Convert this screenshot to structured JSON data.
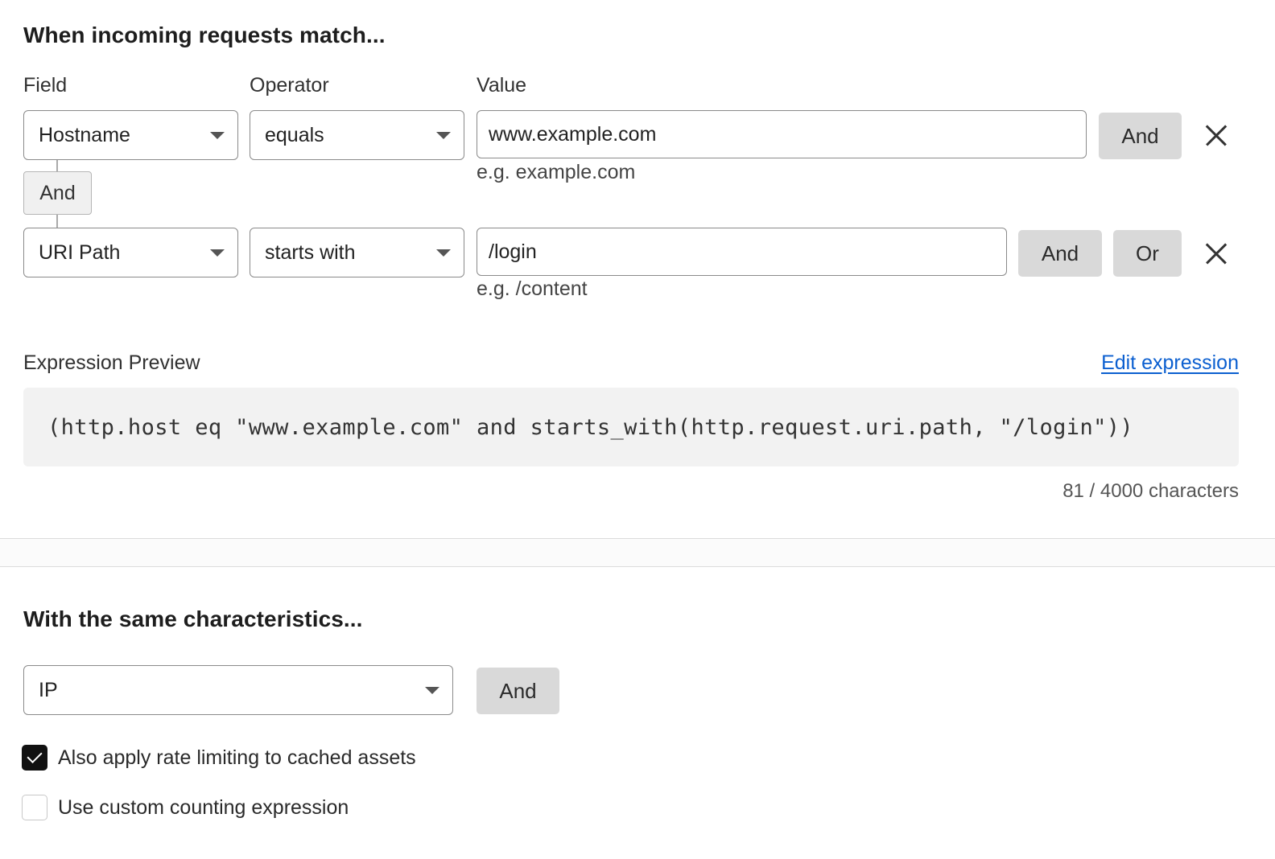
{
  "match_section": {
    "title": "When incoming requests match...",
    "columns": {
      "field": "Field",
      "operator": "Operator",
      "value": "Value"
    },
    "rows": [
      {
        "field": "Hostname",
        "operator": "equals",
        "value": "www.example.com",
        "hint": "e.g. example.com",
        "and_label": "And"
      },
      {
        "field": "URI Path",
        "operator": "starts with",
        "value": "/login",
        "hint": "e.g. /content",
        "and_label": "And",
        "or_label": "Or"
      }
    ],
    "connector_label": "And"
  },
  "expression": {
    "label": "Expression Preview",
    "edit_link": "Edit expression",
    "code": "(http.host eq \"www.example.com\" and starts_with(http.request.uri.path, \"/login\"))",
    "counter": "81 / 4000 characters"
  },
  "characteristics": {
    "title": "With the same characteristics...",
    "select_value": "IP",
    "and_label": "And"
  },
  "options": [
    {
      "label": "Also apply rate limiting to cached assets",
      "checked": true
    },
    {
      "label": "Use custom counting expression",
      "checked": false
    }
  ],
  "colors": {
    "link": "#0b5fd0",
    "button_bg": "#d9d9d9",
    "code_bg": "#f2f2f2",
    "checkbox_checked": "#111111"
  }
}
